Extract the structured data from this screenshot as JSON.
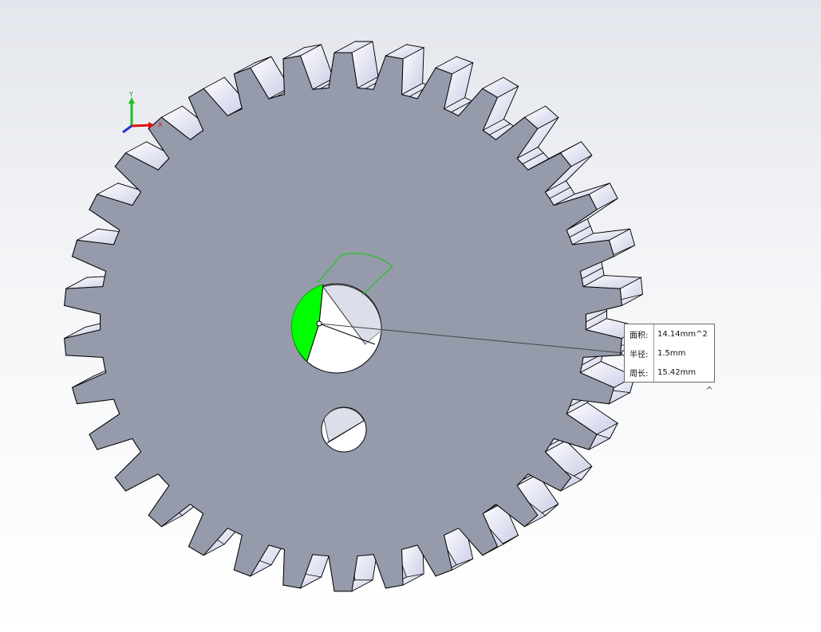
{
  "triad": {
    "y_label": "Y",
    "x_label": "X"
  },
  "measure": {
    "rows": [
      {
        "label": "面积:",
        "value": "14.14mm^2"
      },
      {
        "label": "半径:",
        "value": "1.5mm"
      },
      {
        "label": "周长:",
        "value": "15.42mm"
      }
    ]
  },
  "colors": {
    "gear_face": "#959bab",
    "tooth_side": "#dfe1f2",
    "selection": "#00ff00"
  },
  "icons": {
    "collapse": "chevron-up-icon"
  }
}
